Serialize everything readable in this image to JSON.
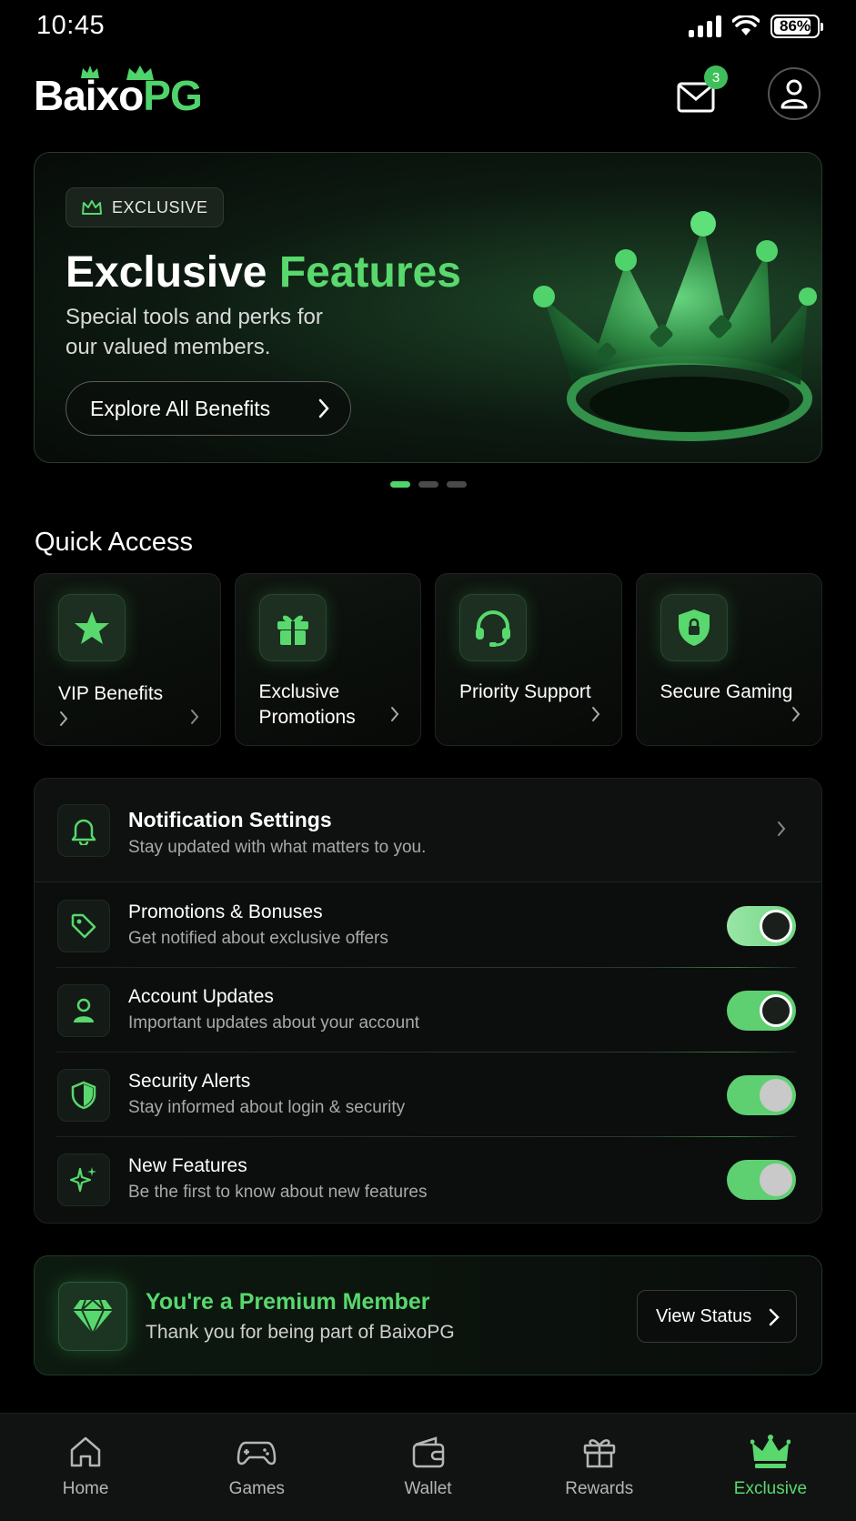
{
  "status_bar": {
    "time": "10:45",
    "battery": "86%"
  },
  "header": {
    "logo_white": "Baixo",
    "logo_green": "PG",
    "mail_badge": "3"
  },
  "hero": {
    "badge": "EXCLUSIVE",
    "title_white": "Exclusive ",
    "title_green": "Features",
    "subtitle": "Special tools and perks for our valued members.",
    "cta": "Explore All Benefits",
    "page_count": 3,
    "active_page": 1
  },
  "quick_access": {
    "title": "Quick Access",
    "items": [
      {
        "label": "VIP Benefits",
        "icon": "star-icon"
      },
      {
        "label": "Exclusive Promotions",
        "icon": "gift-icon"
      },
      {
        "label": "Priority Support",
        "icon": "headset-icon"
      },
      {
        "label": "Secure Gaming",
        "icon": "lock-shield-icon"
      }
    ]
  },
  "notifications": {
    "title": "Notification Settings",
    "subtitle": "Stay updated with what matters to you.",
    "rows": [
      {
        "title": "Promotions & Bonuses",
        "subtitle": "Get notified about exclusive offers",
        "icon": "tag-icon",
        "on": true
      },
      {
        "title": "Account Updates",
        "subtitle": "Important updates about your account",
        "icon": "user-icon",
        "on": true
      },
      {
        "title": "Security Alerts",
        "subtitle": "Stay informed about login & security",
        "icon": "shield-icon",
        "on": true
      },
      {
        "title": "New Features",
        "subtitle": "Be the first to know about new features",
        "icon": "sparkle-icon",
        "on": true
      }
    ]
  },
  "premium": {
    "title": "You're a Premium Member",
    "subtitle": "Thank you for being part of BaixoPG",
    "button": "View Status"
  },
  "nav": {
    "items": [
      {
        "label": "Home",
        "icon": "home-icon"
      },
      {
        "label": "Games",
        "icon": "gamepad-icon"
      },
      {
        "label": "Wallet",
        "icon": "wallet-icon"
      },
      {
        "label": "Rewards",
        "icon": "gift-icon"
      },
      {
        "label": "Exclusive",
        "icon": "crown-icon",
        "active": true
      }
    ]
  },
  "colors": {
    "accent": "#58d86d",
    "background": "#000000",
    "toggle_on": "#5ed072"
  }
}
